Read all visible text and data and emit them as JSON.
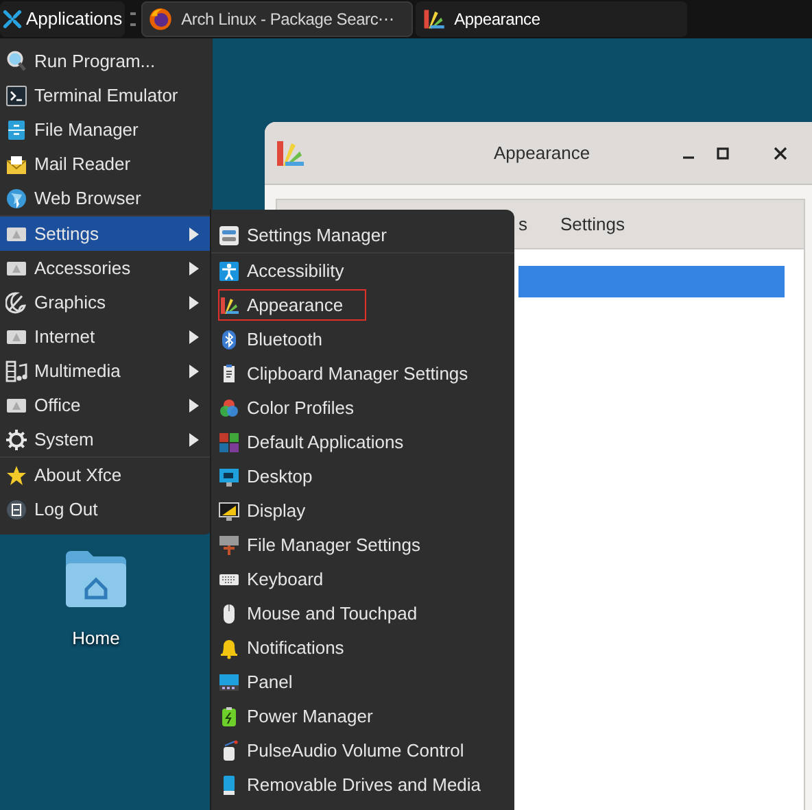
{
  "taskbar": {
    "apps_button": "Applications",
    "tasks": [
      {
        "title": "Arch Linux - Package Searc⋯",
        "selected": false
      },
      {
        "title": "Appearance",
        "selected": true
      }
    ]
  },
  "desktop_icons": [
    {
      "label": "Home"
    }
  ],
  "window": {
    "title": "Appearance",
    "tabs": [
      {
        "label": "s"
      },
      {
        "label": "Settings"
      }
    ],
    "list": {
      "rows": [
        {
          "selected": true
        }
      ]
    }
  },
  "menu": {
    "groups": [
      [
        {
          "label": "Run Program...",
          "submenu": false,
          "selected": false
        },
        {
          "label": "Terminal Emulator",
          "submenu": false,
          "selected": false
        },
        {
          "label": "File Manager",
          "submenu": false,
          "selected": false
        },
        {
          "label": "Mail Reader",
          "submenu": false,
          "selected": false
        },
        {
          "label": "Web Browser",
          "submenu": false,
          "selected": false
        }
      ],
      [
        {
          "label": "Settings",
          "submenu": true,
          "selected": true
        },
        {
          "label": "Accessories",
          "submenu": true,
          "selected": false
        },
        {
          "label": "Graphics",
          "submenu": true,
          "selected": false
        },
        {
          "label": "Internet",
          "submenu": true,
          "selected": false
        },
        {
          "label": "Multimedia",
          "submenu": true,
          "selected": false
        },
        {
          "label": "Office",
          "submenu": true,
          "selected": false
        },
        {
          "label": "System",
          "submenu": true,
          "selected": false
        }
      ],
      [
        {
          "label": "About Xfce",
          "submenu": false,
          "selected": false
        },
        {
          "label": "Log Out",
          "submenu": false,
          "selected": false
        }
      ]
    ]
  },
  "submenu": {
    "groups": [
      [
        {
          "label": "Settings Manager",
          "outlined": false
        }
      ],
      [
        {
          "label": "Accessibility",
          "outlined": false
        },
        {
          "label": "Appearance",
          "outlined": true
        },
        {
          "label": "Bluetooth",
          "outlined": false
        },
        {
          "label": "Clipboard Manager Settings",
          "outlined": false
        },
        {
          "label": "Color Profiles",
          "outlined": false
        },
        {
          "label": "Default Applications",
          "outlined": false
        },
        {
          "label": "Desktop",
          "outlined": false
        },
        {
          "label": "Display",
          "outlined": false
        },
        {
          "label": "File Manager Settings",
          "outlined": false
        },
        {
          "label": "Keyboard",
          "outlined": false
        },
        {
          "label": "Mouse and Touchpad",
          "outlined": false
        },
        {
          "label": "Notifications",
          "outlined": false
        },
        {
          "label": "Panel",
          "outlined": false
        },
        {
          "label": "Power Manager",
          "outlined": false
        },
        {
          "label": "PulseAudio Volume Control",
          "outlined": false
        },
        {
          "label": "Removable Drives and Media",
          "outlined": false
        }
      ]
    ]
  }
}
